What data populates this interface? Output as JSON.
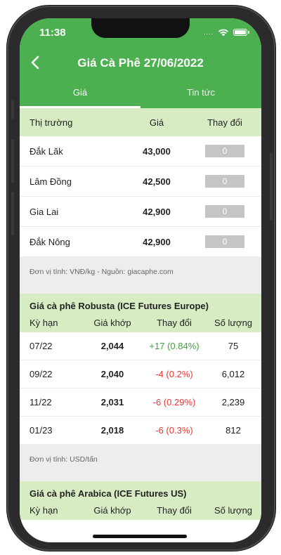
{
  "status": {
    "time": "11:38"
  },
  "header": {
    "title": "Giá Cà Phê 27/06/2022"
  },
  "tabs": [
    {
      "label": "Giá"
    },
    {
      "label": "Tin tức"
    }
  ],
  "domestic": {
    "columns": {
      "market": "Thị trường",
      "price": "Giá",
      "change": "Thay đổi"
    },
    "rows": [
      {
        "market": "Đắk Lăk",
        "price": "43,000",
        "change": "0"
      },
      {
        "market": "Lâm Đồng",
        "price": "42,500",
        "change": "0"
      },
      {
        "market": "Gia Lai",
        "price": "42,900",
        "change": "0"
      },
      {
        "market": "Đắk Nông",
        "price": "42,900",
        "change": "0"
      }
    ],
    "note": "Đơn vị tính: VNĐ/kg - Nguồn: giacaphe.com"
  },
  "robusta": {
    "title": "Giá cà phê Robusta (ICE Futures Europe)",
    "columns": {
      "term": "Kỳ hạn",
      "price": "Giá khớp",
      "change": "Thay đổi",
      "volume": "Số lượng"
    },
    "rows": [
      {
        "term": "07/22",
        "price": "2,044",
        "change": "+17 (0.84%)",
        "volume": "75",
        "direction": "up"
      },
      {
        "term": "09/22",
        "price": "2,040",
        "change": "-4 (0.2%)",
        "volume": "6,012",
        "direction": "down"
      },
      {
        "term": "11/22",
        "price": "2,031",
        "change": "-6 (0.29%)",
        "volume": "2,239",
        "direction": "down"
      },
      {
        "term": "01/23",
        "price": "2,018",
        "change": "-6 (0.3%)",
        "volume": "812",
        "direction": "down"
      }
    ],
    "note": "Đơn vị tính: USD/tấn"
  },
  "arabica": {
    "title": "Giá cà phê Arabica (ICE Futures US)",
    "columns": {
      "term": "Kỳ hạn",
      "price": "Giá khớp",
      "change": "Thay đổi",
      "volume": "Số lượng"
    }
  },
  "colors": {
    "primary": "#4caf50",
    "header_band": "#d8ecc4",
    "up": "#3ea23e",
    "down": "#e53935",
    "chip": "#c5c5c5"
  }
}
